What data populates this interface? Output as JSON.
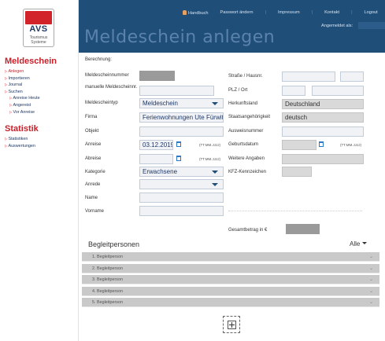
{
  "header": {
    "nav": [
      "Handbuch",
      "Passwort ändern",
      "Impressum",
      "Kontakt",
      "Logout"
    ],
    "logged_in_label": "Angemeldet als:",
    "page_title": "Meldeschein anlegen"
  },
  "logo": {
    "brand": "AVS",
    "line1": "Tourismus",
    "line2": "Systeme"
  },
  "sidebar": {
    "section1_title": "Meldeschein",
    "section1_items": [
      "Anlegen",
      "Importieren",
      "Journal",
      "Suchen"
    ],
    "section1_subitems": [
      "Anreise Heute",
      "Angereist",
      "Vor Anreise"
    ],
    "section2_title": "Statistik",
    "section2_items": [
      "Statistiken",
      "Auswertungen"
    ]
  },
  "form": {
    "berechnung_label": "Berechnung:",
    "meldescheinnummer_label": "Meldescheinnummer",
    "manuelle_label": "manuelle Meldescheinnr.",
    "meldescheintyp_label": "Meldescheintyp",
    "meldescheintyp_value": "Meldeschein",
    "firma_label": "Firma",
    "firma_value": "Ferienwohnungen Ute Fürwitt",
    "objekt_label": "Objekt",
    "anreise_label": "Anreise",
    "anreise_value": "03.12.2019",
    "abreise_label": "Abreise",
    "date_hint": "(TT.MM.JJJJ)",
    "kategorie_label": "Kategorie",
    "kategorie_value": "Erwachsene",
    "anrede_label": "Anrede",
    "name_label": "Name",
    "vorname_label": "Vorname",
    "strasse_label": "Straße / Hausnr.",
    "plz_label": "PLZ / Ort",
    "herkunftsland_label": "Herkunftsland",
    "herkunftsland_value": "Deutschland",
    "staatsangehoerigkeit_label": "Staatsangehörigkeit",
    "staatsangehoerigkeit_value": "deutsch",
    "ausweisnummer_label": "Ausweisnummer",
    "geburtsdatum_label": "Geburtsdatum",
    "weitere_label": "Weitere Angaben",
    "kfz_label": "KFZ-Kennzeichen",
    "gesamtbetrag_label": "Gesamtbetrag in €"
  },
  "companions": {
    "title": "Begleitpersonen",
    "filter": "Alle",
    "rows": [
      "1. Begleitperson",
      "2. Begleitperson",
      "3. Begleitperson",
      "4. Begleitperson",
      "5. Begleitperson"
    ]
  },
  "icons": [
    "user-icon",
    "calendar-icon",
    "chevron-down-icon",
    "plus-icon"
  ]
}
